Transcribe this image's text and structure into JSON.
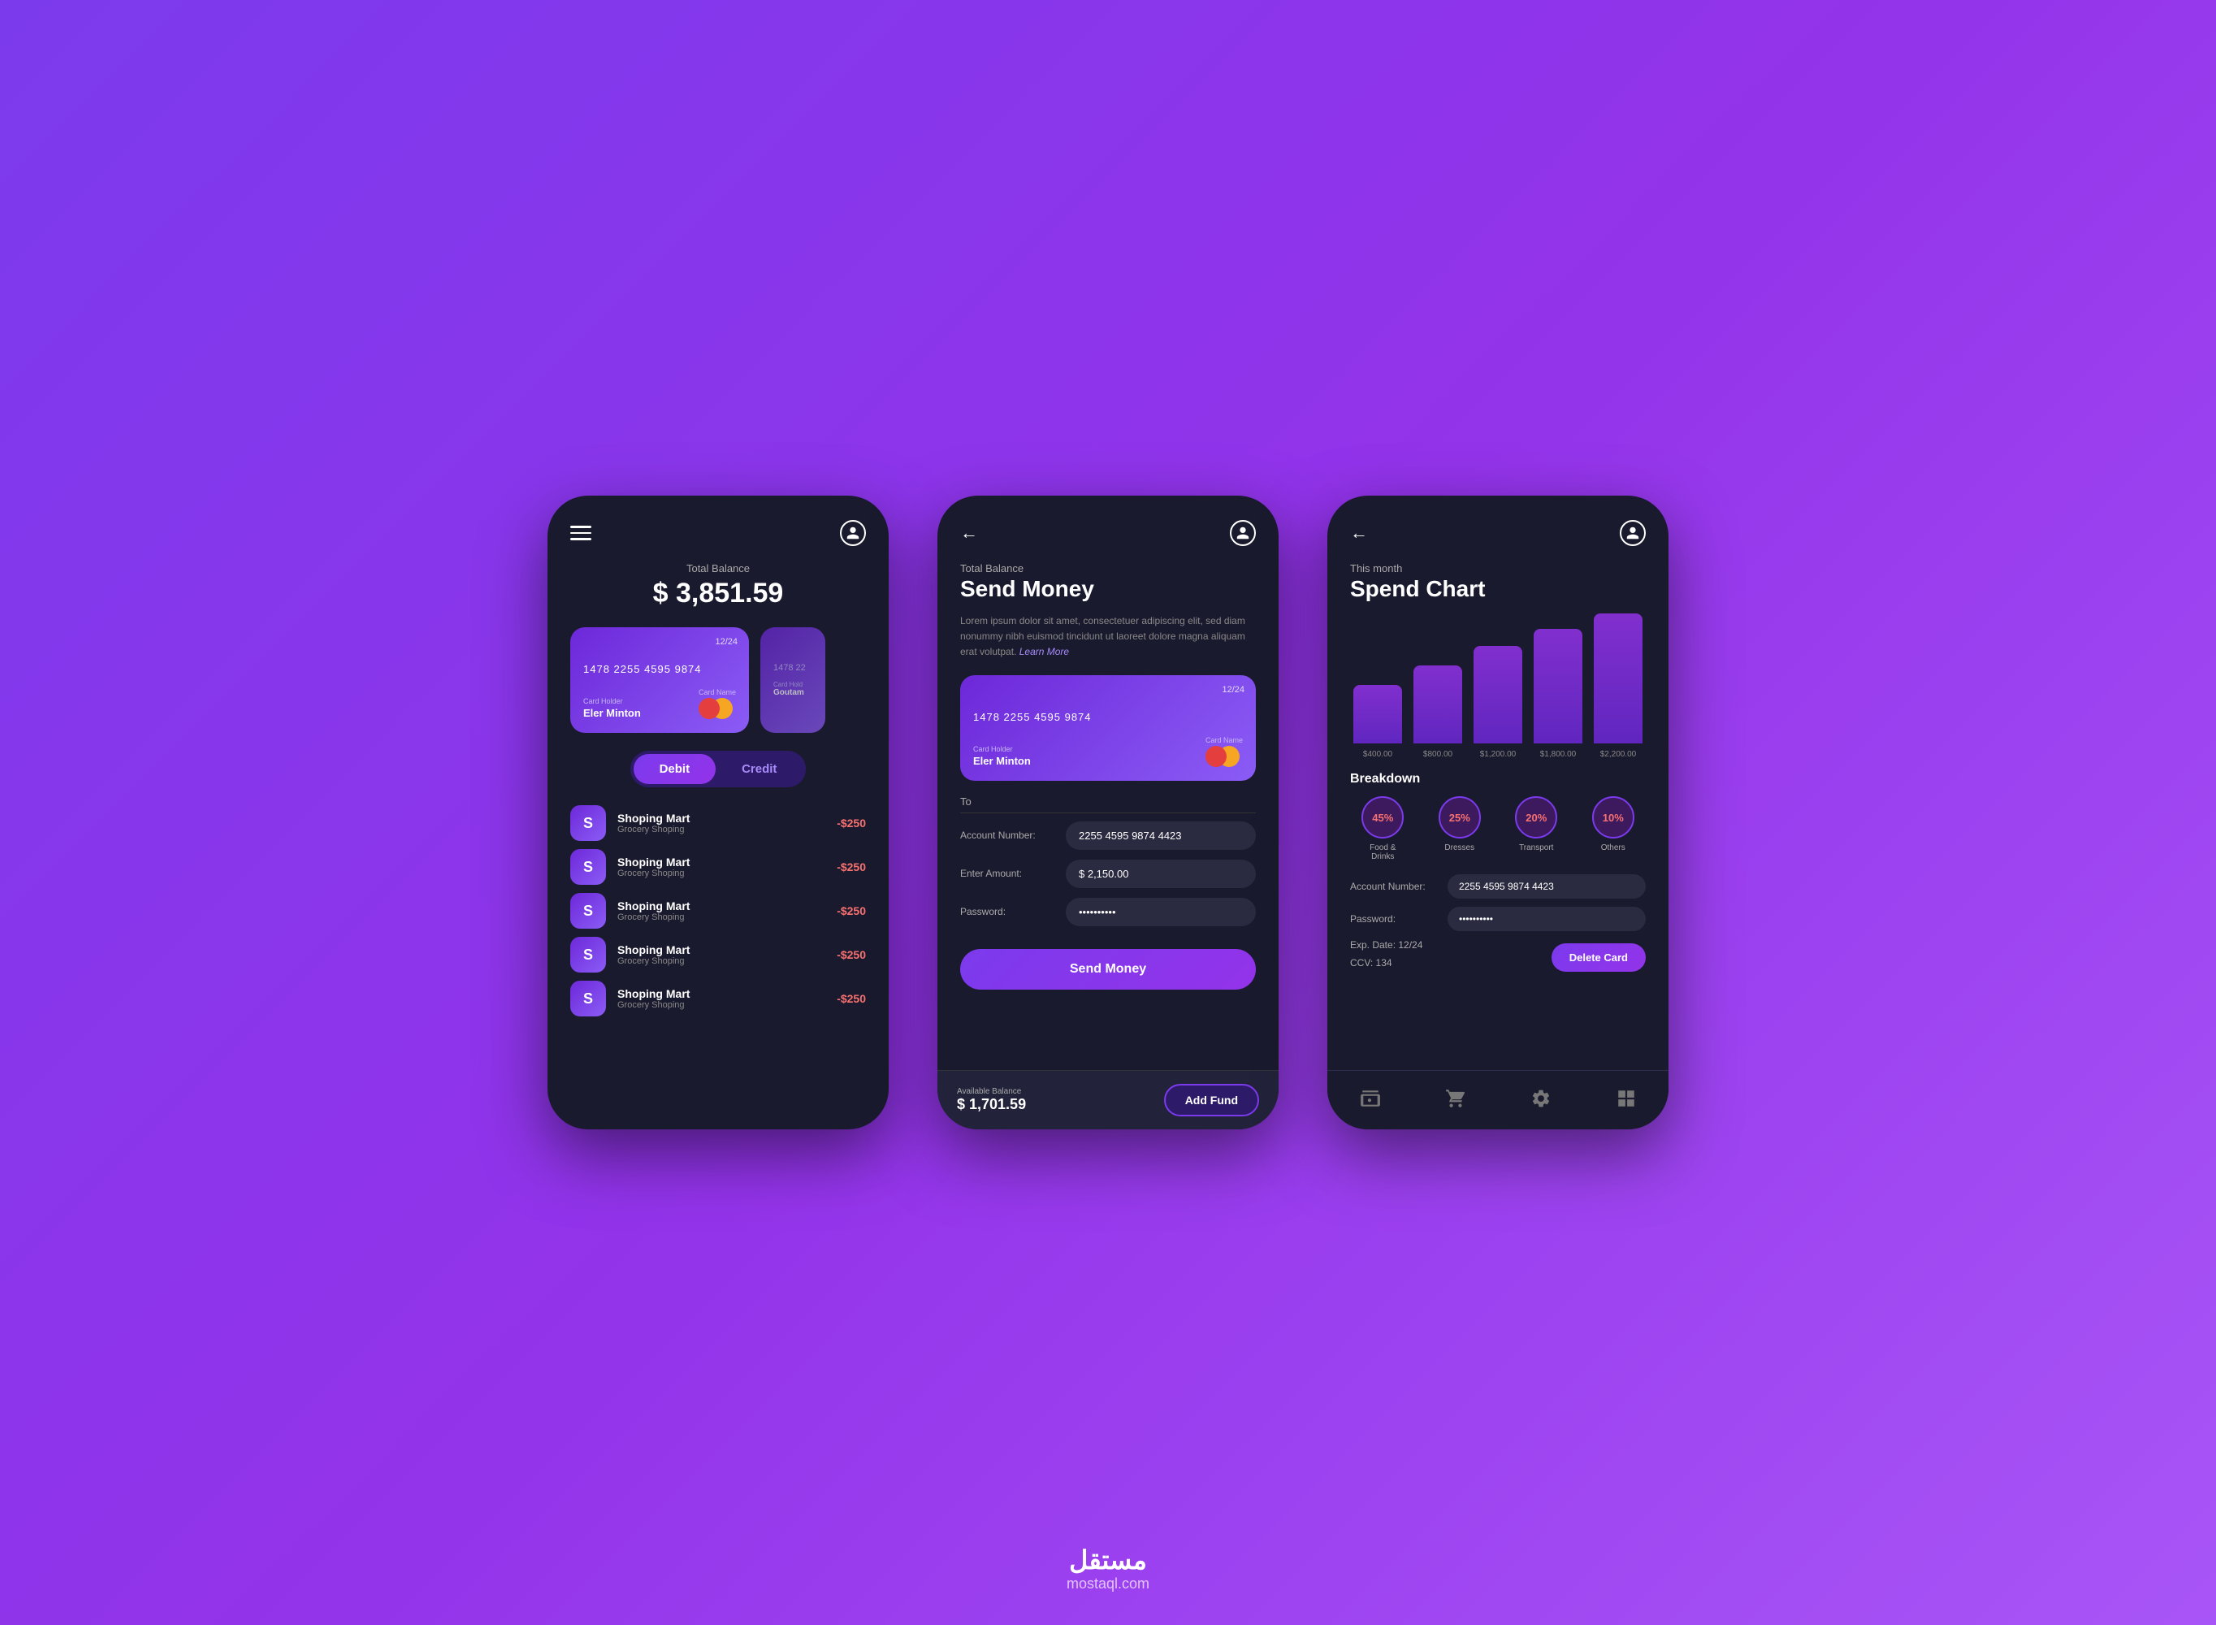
{
  "background": "#9333ea",
  "phone1": {
    "header": {
      "menu_icon": "hamburger",
      "user_icon": "user-circle"
    },
    "balance": {
      "label": "Total Balance",
      "amount": "$ 3,851.59"
    },
    "cards": [
      {
        "expiry": "12/24",
        "number": "1478 2255 4595 9874",
        "holder_label": "Card Holder",
        "holder_name": "Eler Minton",
        "card_name_label": "Card Name",
        "card_name": ""
      },
      {
        "number": "1478 22",
        "holder_label": "Card Hold",
        "holder_name": "Goutam"
      }
    ],
    "toggle": {
      "debit": "Debit",
      "credit": "Credit",
      "active": "debit"
    },
    "transactions": [
      {
        "icon": "S",
        "name": "Shoping Mart",
        "sub": "Grocery Shoping",
        "amount": "-$250"
      },
      {
        "icon": "S",
        "name": "Shoping Mart",
        "sub": "Grocery Shoping",
        "amount": "-$250"
      },
      {
        "icon": "S",
        "name": "Shoping Mart",
        "sub": "Grocery Shoping",
        "amount": "-$250"
      },
      {
        "icon": "S",
        "name": "Shoping Mart",
        "sub": "Grocery Shoping",
        "amount": "-$250"
      },
      {
        "icon": "S",
        "name": "Shoping Mart",
        "sub": "Grocery Shoping",
        "amount": "-$250"
      }
    ]
  },
  "phone2": {
    "header": {
      "back_icon": "arrow-left",
      "user_icon": "user-circle"
    },
    "page": {
      "subtitle": "Total Balance",
      "title": "Send Money",
      "description": "Lorem ipsum dolor sit amet, consectetuer adipiscing elit, sed diam nonummy nibh euismod tincidunt ut laoreet dolore magna aliquam erat volutpat.",
      "learn_more": "Learn More"
    },
    "card": {
      "expiry": "12/24",
      "number": "1478 2255 4595 9874",
      "holder_label": "Card Holder",
      "holder_name": "Eler Minton",
      "card_name_label": "Card Name"
    },
    "form": {
      "to_label": "To",
      "account_label": "Account Number:",
      "account_value": "2255 4595 9874 4423",
      "amount_label": "Enter Amount:",
      "amount_value": "$ 2,150.00",
      "password_label": "Password:",
      "password_value": "••••••••••",
      "send_btn": "Send Money"
    },
    "bottom": {
      "balance_label": "Available Balance",
      "balance_amount": "$ 1,701.59",
      "add_fund_btn": "Add Fund"
    }
  },
  "phone3": {
    "header": {
      "back_icon": "arrow-left",
      "user_icon": "user-circle"
    },
    "page": {
      "subtitle": "This month",
      "title": "Spend Chart"
    },
    "chart": {
      "bars": [
        45,
        65,
        80,
        90,
        100
      ],
      "labels": [
        "$400.00",
        "$800.00",
        "$1,200.00",
        "$1,800.00",
        "$2,200.00"
      ]
    },
    "breakdown": {
      "title": "Breakdown",
      "items": [
        {
          "percent": "45%",
          "label": "Food &\nDrinks"
        },
        {
          "percent": "25%",
          "label": "Dresses"
        },
        {
          "percent": "20%",
          "label": "Transport"
        },
        {
          "percent": "10%",
          "label": "Others"
        }
      ]
    },
    "info": {
      "account_label": "Account Number:",
      "account_value": "2255 4595 9874 4423",
      "password_label": "Password:",
      "password_value": "••••••••••",
      "exp_label": "Exp. Date: 12/24",
      "ccv_label": "CCV: 134",
      "delete_btn": "Delete Card"
    },
    "nav": {
      "icons": [
        "wallet",
        "cart",
        "gear",
        "grid"
      ]
    }
  },
  "watermark": {
    "arabic": "مستقل",
    "latin": "mostaql.com"
  }
}
